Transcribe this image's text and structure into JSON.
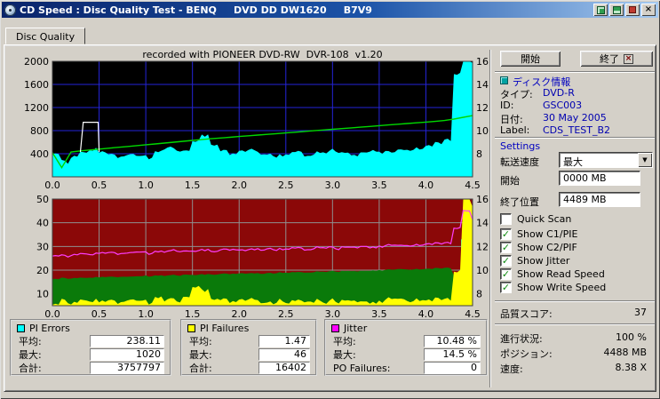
{
  "window": {
    "title": "CD Speed : Disc Quality Test - BENQ     DVD DD DW1620     B7V9"
  },
  "tabs": [
    {
      "label": "Disc Quality"
    }
  ],
  "chart_header": "recorded with PIONEER DVD-RW  DVR-108  v1.20",
  "icons": {
    "close": "×",
    "exit": "×",
    "dropdown": "▼"
  },
  "chart_data": [
    {
      "name": "pi_errors_and_write_speed",
      "type": "area",
      "title": "recorded with PIONEER DVD-RW  DVR-108  v1.20",
      "xlim": [
        0,
        4.5
      ],
      "x_step": 0.1,
      "ylim": [
        0,
        2000
      ],
      "bg": "#000000",
      "grid_color": "#2424d8",
      "grid_x": [
        0.5,
        1.0,
        1.5,
        2.0,
        2.5,
        3.0,
        3.5,
        4.0
      ],
      "grid_y": [
        400,
        800,
        1200,
        1600,
        2000
      ],
      "left_ticks": [
        {
          "v": 2000,
          "label": "2000"
        },
        {
          "v": 1600,
          "label": "1600"
        },
        {
          "v": 1200,
          "label": "1200"
        },
        {
          "v": 800,
          "label": "800"
        },
        {
          "v": 400,
          "label": "400"
        }
      ],
      "right_ticks": [
        {
          "v": 2000,
          "label": "16"
        },
        {
          "v": 1600,
          "label": "14"
        },
        {
          "v": 1200,
          "label": "12"
        },
        {
          "v": 800,
          "label": "10"
        },
        {
          "v": 400,
          "label": "8"
        }
      ],
      "x_ticks": [
        "0.0",
        "0.5",
        "1.0",
        "1.5",
        "2.0",
        "2.5",
        "3.0",
        "3.5",
        "4.0",
        "4.5"
      ],
      "x_tick_step": 0.5,
      "series": [
        {
          "name": "pi_errors_area",
          "kind": "area",
          "color": "#00ffff",
          "noise": 38,
          "values": [
            430,
            260,
            360,
            430,
            470,
            420,
            380,
            350,
            390,
            360,
            340,
            420,
            500,
            460,
            430,
            620,
            700,
            560,
            430,
            390,
            430,
            460,
            420,
            390,
            360,
            400,
            430,
            390,
            410,
            430,
            450,
            410,
            390,
            430,
            460,
            430,
            410,
            440,
            470,
            490,
            530,
            570,
            650,
            1800,
            2000,
            1950
          ]
        },
        {
          "name": "write_speed_line",
          "kind": "line",
          "color": "#00d800",
          "width": 1.4,
          "values": [
            420,
            160,
            430,
            450,
            465,
            480,
            495,
            510,
            525,
            540,
            555,
            570,
            585,
            600,
            615,
            630,
            645,
            660,
            672,
            685,
            698,
            710,
            723,
            736,
            748,
            760,
            773,
            786,
            798,
            810,
            823,
            836,
            848,
            860,
            873,
            886,
            898,
            910,
            923,
            936,
            948,
            960,
            975,
            1000,
            1030,
            1060
          ]
        },
        {
          "name": "start_marker_line",
          "kind": "line",
          "color": "#ffffff",
          "width": 1.2,
          "points": [
            [
              0.3,
              430
            ],
            [
              0.33,
              945
            ],
            [
              0.49,
              945
            ],
            [
              0.5,
              430
            ]
          ]
        }
      ]
    },
    {
      "name": "pi_failures_and_jitter",
      "type": "area",
      "xlim": [
        0,
        4.5
      ],
      "x_step": 0.1,
      "ylim": [
        5,
        50
      ],
      "bg": "#8b0808",
      "grid_color": "#8f8f8f",
      "grid_x": [
        0.5,
        1.0,
        1.5,
        2.0,
        2.5,
        3.0,
        3.5,
        4.0
      ],
      "grid_y": [
        10,
        20,
        30,
        40,
        50
      ],
      "left_ticks": [
        {
          "v": 50,
          "label": "50"
        },
        {
          "v": 40,
          "label": "40"
        },
        {
          "v": 30,
          "label": "30"
        },
        {
          "v": 20,
          "label": "20"
        },
        {
          "v": 10,
          "label": "10"
        }
      ],
      "right_ticks": [
        {
          "v": 50,
          "label": "16"
        },
        {
          "v": 40,
          "label": "14"
        },
        {
          "v": 30,
          "label": "12"
        },
        {
          "v": 20,
          "label": "10"
        },
        {
          "v": 10,
          "label": "8"
        }
      ],
      "x_ticks": [
        "0.0",
        "0.5",
        "1.0",
        "1.5",
        "2.0",
        "2.5",
        "3.0",
        "3.5",
        "4.0",
        "4.5"
      ],
      "x_tick_step": 0.5,
      "series": [
        {
          "name": "read_speed_area",
          "kind": "area",
          "color": "#0a7a0a",
          "noise": 0.3,
          "values": [
            16.5,
            16.6,
            16.7,
            16.8,
            16.9,
            17.0,
            17.1,
            17.2,
            17.3,
            17.4,
            17.5,
            17.6,
            17.7,
            17.8,
            17.9,
            18.0,
            18.1,
            18.2,
            18.3,
            18.4,
            18.5,
            18.6,
            18.7,
            18.8,
            18.9,
            19.0,
            19.1,
            19.2,
            19.3,
            19.4,
            19.5,
            19.6,
            19.7,
            19.8,
            19.9,
            20.0,
            20.1,
            20.2,
            20.3,
            20.4,
            20.5,
            20.7,
            21.0,
            18.0,
            13.0,
            12.0
          ]
        },
        {
          "name": "pie_endcap_bars",
          "kind": "bars",
          "color": "#00ffff",
          "bw": 5,
          "values": [
            5,
            5,
            5,
            5,
            5,
            5,
            5,
            5,
            5,
            5,
            5,
            5,
            5,
            5,
            5,
            5,
            5,
            5,
            5,
            5,
            5,
            5,
            5,
            5,
            5,
            5,
            5,
            5,
            5,
            5,
            5,
            5,
            5,
            5,
            5,
            5,
            5,
            5,
            5,
            5,
            5,
            5,
            5,
            5,
            33,
            5
          ]
        },
        {
          "name": "pi_failures_area",
          "kind": "area",
          "color": "#ffff00",
          "noise": 1.1,
          "values": [
            6.5,
            7,
            6.5,
            7.5,
            7,
            6.5,
            7,
            6.5,
            7.5,
            7,
            6.5,
            8,
            7.5,
            7,
            8,
            13,
            11,
            8,
            7,
            6.5,
            7,
            7.5,
            7,
            6.5,
            7,
            6.5,
            7,
            7.5,
            7,
            6.5,
            7,
            7,
            7.5,
            7,
            6.5,
            7,
            7.5,
            7,
            7,
            7.5,
            7,
            7.5,
            8,
            20,
            50,
            46
          ]
        },
        {
          "name": "jitter_line",
          "kind": "line",
          "color": "#ff3dff",
          "width": 1.2,
          "noise": 0.55,
          "values": [
            26.5,
            26.0,
            26.6,
            27.0,
            26.7,
            27.1,
            27.3,
            27.0,
            27.4,
            27.6,
            27.2,
            27.6,
            27.9,
            28.1,
            27.7,
            28.1,
            28.3,
            28.0,
            28.4,
            28.6,
            28.2,
            28.6,
            28.9,
            29.1,
            28.7,
            29.1,
            29.3,
            29.0,
            29.4,
            29.6,
            29.2,
            29.6,
            29.9,
            30.1,
            29.7,
            30.1,
            30.3,
            30.0,
            30.4,
            30.6,
            30.9,
            31.1,
            31.6,
            38.0,
            45.0,
            41.0
          ]
        }
      ]
    }
  ],
  "stats_boxes": [
    {
      "title": "PI Errors",
      "swatch": "#00ffff",
      "rows": [
        {
          "label": "平均:",
          "value": "238.11"
        },
        {
          "label": "最大:",
          "value": "1020"
        },
        {
          "label": "合計:",
          "value": "3757797"
        }
      ]
    },
    {
      "title": "PI Failures",
      "swatch": "#ffff00",
      "rows": [
        {
          "label": "平均:",
          "value": "1.47"
        },
        {
          "label": "最大:",
          "value": "46"
        },
        {
          "label": "合計:",
          "value": "16402"
        }
      ]
    },
    {
      "title": "Jitter",
      "swatch": "#ff00ff",
      "rows": [
        {
          "label": "平均:",
          "value": "10.48 %"
        },
        {
          "label": "最大:",
          "value": "14.5 %"
        },
        {
          "label": "PO Failures:",
          "value": "0"
        }
      ]
    }
  ],
  "actions": {
    "start_label": "開始",
    "exit_label": "終了"
  },
  "disc_info": {
    "header": "ディスク情報",
    "rows": [
      {
        "label": "タイプ:",
        "value": "DVD-R"
      },
      {
        "label": "ID:",
        "value": "GSC003"
      },
      {
        "label": "日付:",
        "value": "30 May 2005"
      },
      {
        "label": "Label:",
        "value": "CDS_TEST_B2"
      }
    ]
  },
  "settings": {
    "header": "Settings",
    "speed_label": "転送速度",
    "speed_value": "最大",
    "start_label": "開始",
    "start_value": "0000 MB",
    "end_label": "終了位置",
    "end_value": "4489 MB",
    "checkboxes": [
      {
        "label": "Quick Scan",
        "checked": false,
        "glyph": ""
      },
      {
        "label": "Show C1/PIE",
        "checked": true,
        "glyph": "✓"
      },
      {
        "label": "Show C2/PIF",
        "checked": true,
        "glyph": "✓"
      },
      {
        "label": "Show Jitter",
        "checked": true,
        "glyph": "✓"
      },
      {
        "label": "Show Read Speed",
        "checked": true,
        "glyph": "✓"
      },
      {
        "label": "Show Write Speed",
        "checked": true,
        "glyph": "✓"
      }
    ]
  },
  "results": {
    "score_label": "品質スコア:",
    "score_value": "37",
    "progress_label": "進行状況:",
    "progress_value": "100 %",
    "position_label": "ポジション:",
    "position_value": "4488 MB",
    "speed_label": "速度:",
    "speed_value": "8.38 X"
  }
}
